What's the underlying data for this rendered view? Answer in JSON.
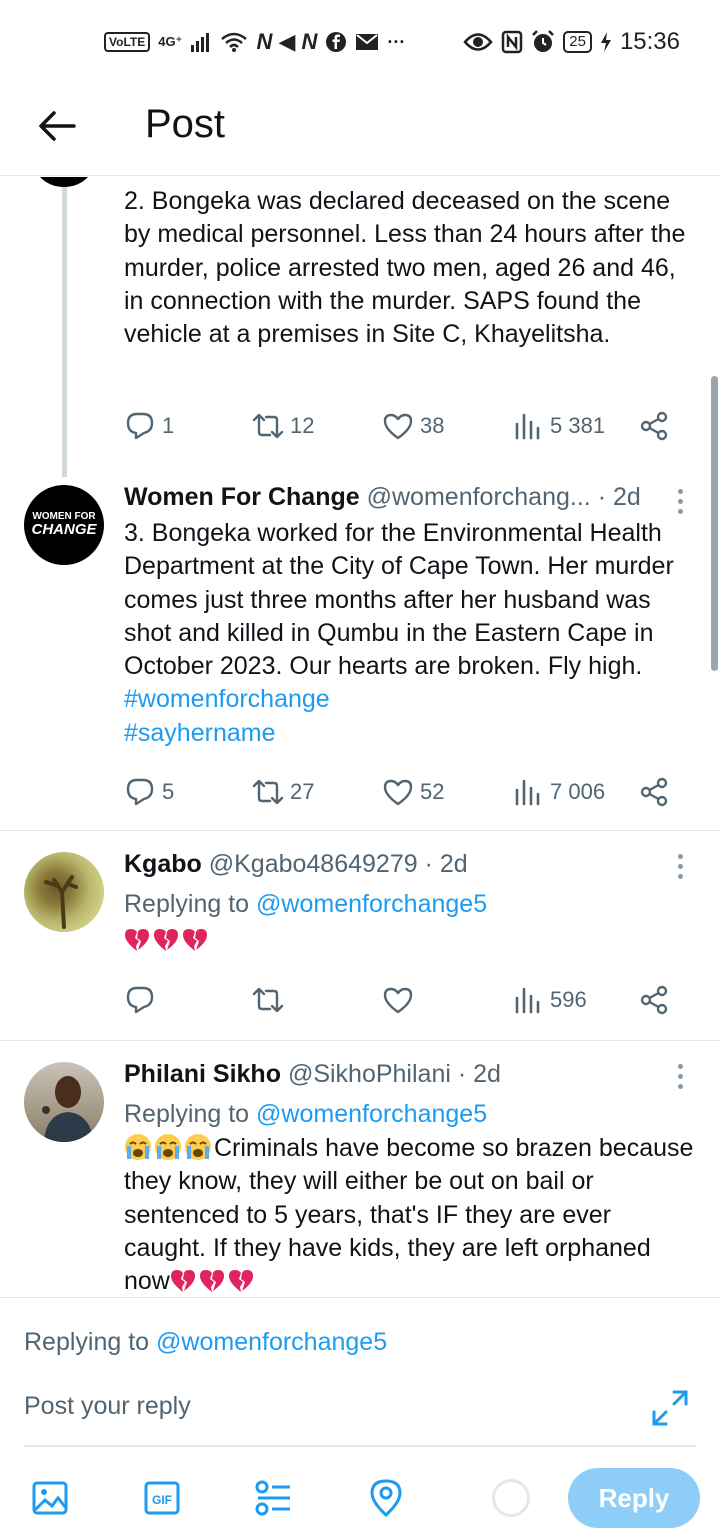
{
  "statusbar": {
    "volte": "VoLTE",
    "network": "4G⁺",
    "left_letters": "N ◀ N",
    "more": "···",
    "battery": "25",
    "time": "15:36"
  },
  "header": {
    "title": "Post"
  },
  "posts": [
    {
      "text": "2. Bongeka was declared deceased on the scene by medical personnel. Less than 24 hours after the murder, police arrested two men, aged 26 and 46, in connection with the murder. SAPS found the vehicle at a premises in Site C, Khayelitsha.",
      "replies": "1",
      "reposts": "12",
      "likes": "38",
      "views": "5 381"
    },
    {
      "name": "Women For Change",
      "handle": "@womenforchang...",
      "time": "· 2d",
      "avatar_text_1": "WOMEN FOR",
      "avatar_text_2": "CHANGE",
      "text": "3. Bongeka worked for the Environmental Health Department at the City of Cape Town. Her murder comes just three months after her husband was shot and killed in Qumbu in the Eastern Cape in October 2023. Our hearts are broken. Fly high. ",
      "hashtag1": "#womenforchange",
      "hashtag2": "#sayhername",
      "replies": "5",
      "reposts": "27",
      "likes": "52",
      "views": "7 006"
    },
    {
      "name": "Kgabo",
      "handle": "@Kgabo48649279",
      "time": "· 2d",
      "replying_prefix": "Replying to ",
      "replying_to": "@womenforchange5",
      "replies": "",
      "reposts": "",
      "likes": "",
      "views": "596"
    },
    {
      "name": "Philani Sikho",
      "handle": "@SikhoPhilani",
      "time": "· 2d",
      "replying_prefix": "Replying to ",
      "replying_to": "@womenforchange5",
      "text": "Criminals have become so brazen because they know, they will either be out on bail or sentenced to 5 years, that's IF they are ever caught. If they have kids, they are left orphaned now"
    }
  ],
  "composer": {
    "replying_prefix": "Replying to ",
    "replying_to": "@womenforchange5",
    "placeholder": "Post your reply",
    "reply_label": "Reply"
  },
  "colors": {
    "accent": "#1d9bf0",
    "reply_button": "#8ecdf7",
    "muted": "#536471"
  },
  "icons": [
    "back-arrow-icon",
    "reply-icon",
    "repost-icon",
    "like-icon",
    "views-icon",
    "share-icon",
    "more-icon",
    "image-icon",
    "gif-icon",
    "poll-icon",
    "location-icon",
    "expand-icon"
  ]
}
